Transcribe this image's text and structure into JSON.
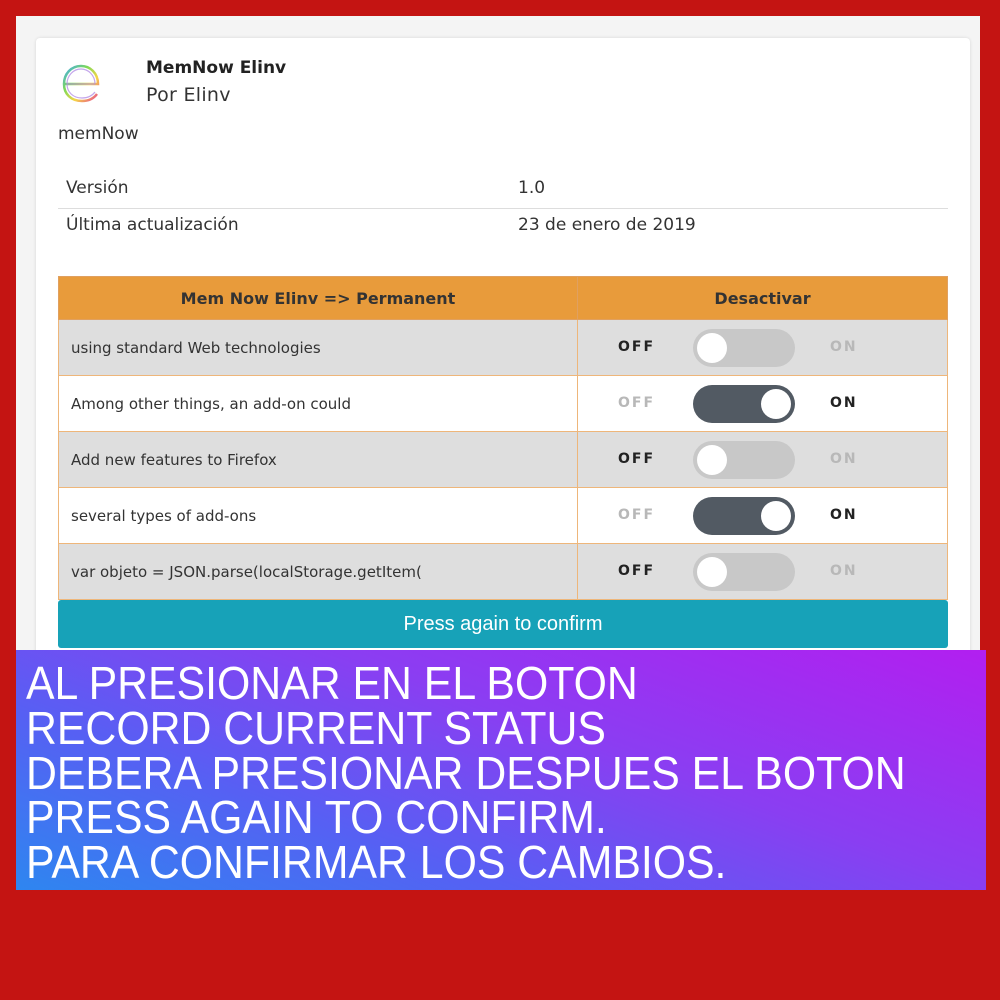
{
  "addon": {
    "name": "MemNow Elinv",
    "author": "Por Elinv",
    "description": "memNow",
    "logo_icon": "elinv-logo-e"
  },
  "info": {
    "version_label": "Versión",
    "version_value": "1.0",
    "updated_label": "Última actualización",
    "updated_value": "23 de enero de 2019"
  },
  "options_table": {
    "header_left": "Mem Now Elinv => Permanent",
    "header_right": "Desactivar",
    "off_label": "OFF",
    "on_label": "ON",
    "rows": [
      {
        "label": "using standard Web technologies",
        "enabled": false
      },
      {
        "label": "Among other things, an add-on could",
        "enabled": true
      },
      {
        "label": "Add new features to Firefox",
        "enabled": false
      },
      {
        "label": "several types of add-ons",
        "enabled": true
      },
      {
        "label": "var objeto = JSON.parse(localStorage.getItem(",
        "enabled": false
      }
    ]
  },
  "confirm_button": "Press again to confirm",
  "banner": {
    "lines": [
      "AL PRESIONAR EN EL BOTON",
      "RECORD CURRENT STATUS",
      "DEBERA PRESIONAR DESPUES EL BOTON",
      "PRESS AGAIN TO CONFIRM.",
      "PARA CONFIRMAR LOS CAMBIOS."
    ]
  },
  "colors": {
    "background": "#c41412",
    "table_header": "#e89b3b",
    "confirm_button": "#17a2b8",
    "switch_on": "#525a63",
    "switch_off": "#c8c8c8"
  }
}
